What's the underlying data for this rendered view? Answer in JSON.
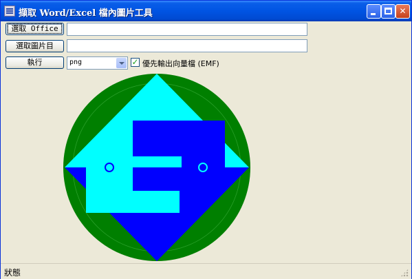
{
  "window": {
    "title": "擷取 Word/Excel 檔內圖片工具",
    "controls": {
      "minimize": "_",
      "maximize": "□",
      "close": "✕"
    }
  },
  "toolbar": {
    "select_office_label": "選取 Office",
    "select_office_path": "",
    "select_image_dir_label": "選取圖片目",
    "image_dir_path": "",
    "execute_label": "執行",
    "format_selected": "png",
    "prefer_vector_checked": true,
    "prefer_vector_label": "優先輸出向量檔 (EMF)"
  },
  "preview": {
    "circle_color": "#007f00",
    "diamond_color": "#00ffff",
    "shape_color": "#0000ff",
    "icon": "emf-logo-preview"
  },
  "status": {
    "text": "狀態"
  }
}
